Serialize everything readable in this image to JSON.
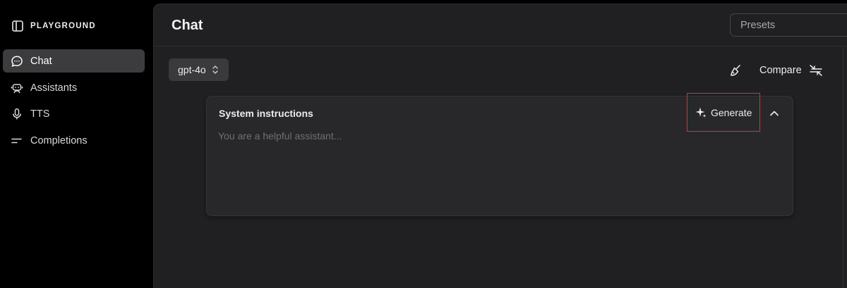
{
  "brand": {
    "text": "PLAYGROUND",
    "icon": "sidebar-panel-icon"
  },
  "sidebar": {
    "items": [
      {
        "label": "Chat",
        "icon": "chat-bubble-icon",
        "active": true
      },
      {
        "label": "Assistants",
        "icon": "robot-icon",
        "active": false
      },
      {
        "label": "TTS",
        "icon": "microphone-icon",
        "active": false
      },
      {
        "label": "Completions",
        "icon": "text-lines-icon",
        "active": false
      }
    ]
  },
  "header": {
    "title": "Chat",
    "presets_placeholder": "Presets"
  },
  "toolbar": {
    "model": "gpt-4o",
    "clear_icon": "broom-icon",
    "compare_label": "Compare",
    "compare_icon": "compare-arrows-icon"
  },
  "system_card": {
    "title": "System instructions",
    "generate_label": "Generate",
    "generate_icon": "sparkle-icon",
    "collapse_icon": "chevron-up-icon",
    "placeholder": "You are a helpful assistant..."
  },
  "colors": {
    "background": "#000000",
    "panel": "#202022",
    "card": "#28282b",
    "active_item": "#3c3c3f",
    "highlight_border": "#d9342b",
    "text": "#ececec",
    "placeholder": "#6f6f74"
  }
}
